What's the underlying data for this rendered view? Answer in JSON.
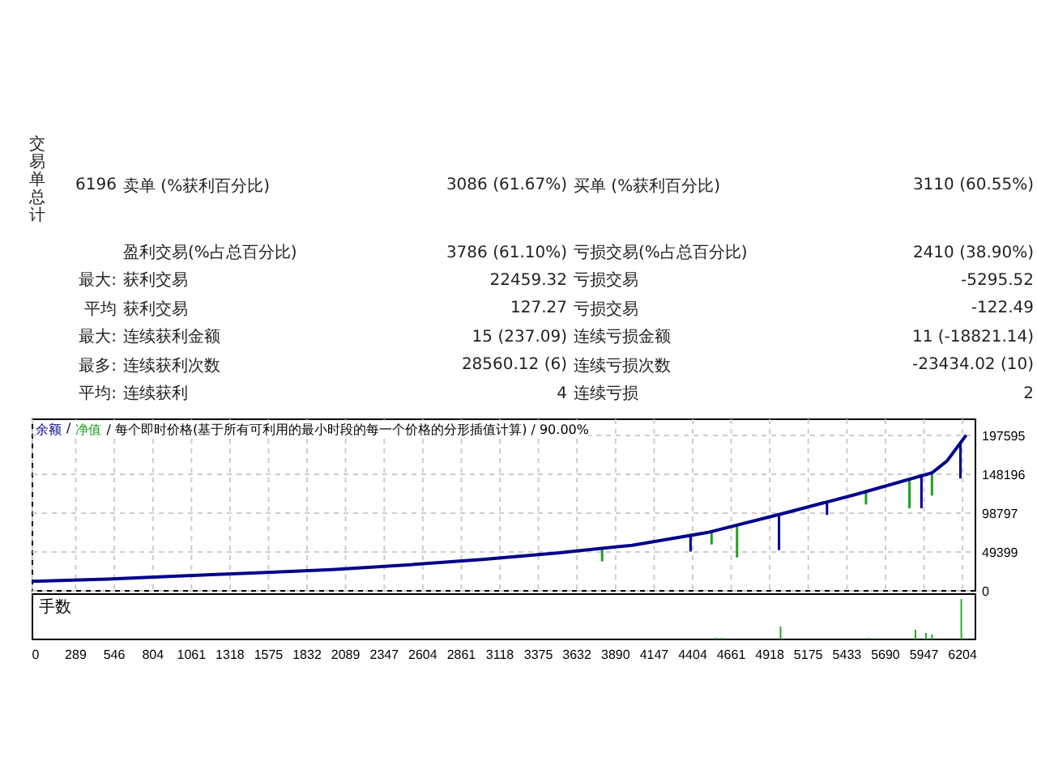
{
  "report": {
    "side_label": "交易单总计",
    "groups": [
      [
        {
          "label": "6196",
          "name": "卖单 (%获利百分比)",
          "value": "3086 (61.67%)",
          "name2": "买单 (%获利百分比)",
          "value2": "3110 (60.55%)"
        }
      ],
      [
        {
          "name": "盈利交易(%占总百分比)",
          "value": "3786 (61.10%)",
          "name2": "亏损交易(%占总百分比)",
          "value2": "2410 (38.90%)"
        },
        {
          "label": "最大:",
          "name": "获利交易",
          "value": "22459.32",
          "name2": "亏损交易",
          "value2": "-5295.52"
        },
        {
          "label": "平均",
          "name": "获利交易",
          "value": "127.27",
          "name2": "亏损交易",
          "value2": "-122.49"
        },
        {
          "label": "最大:",
          "name": "连续获利金额",
          "value": "15 (237.09)",
          "name2": "连续亏损金额",
          "value2": "11 (-18821.14)"
        },
        {
          "label": "最多:",
          "name": "连续获利次数",
          "value": "28560.12 (6)",
          "name2": "连续亏损次数",
          "value2": "-23434.02 (10)"
        },
        {
          "label": "平均:",
          "name": "连续获利",
          "value": "4",
          "name2": "连续亏损",
          "value2": "2"
        }
      ]
    ]
  },
  "chart": {
    "header": [
      {
        "text": "/",
        "color": "#000000"
      },
      {
        "text": "净值",
        "color": "#20a020"
      },
      {
        "text": "/ 每个即时价格(基于所有可利用的最小时段的每一个价格的分形插值计算) / 90.00%",
        "color": "#000000"
      }
    ],
    "volume_label": "手数",
    "chart_data": {
      "type": "line",
      "x": [
        0,
        500,
        1000,
        1500,
        2000,
        2500,
        3000,
        3500,
        4000,
        4500,
        5000,
        5500,
        6000,
        6100,
        6228
      ],
      "series": [
        {
          "name": "余额",
          "color": "#00008b",
          "values": [
            12000,
            15000,
            19000,
            23000,
            27000,
            33000,
            40000,
            48000,
            58000,
            74000,
            98000,
            123000,
            150000,
            165000,
            198000
          ]
        }
      ],
      "grid": true,
      "xlim": [
        0,
        6290
      ],
      "ylim": [
        0,
        218180
      ],
      "xticks": [
        0,
        289,
        546,
        804,
        1061,
        1318,
        1575,
        1832,
        2089,
        2347,
        2604,
        2861,
        3118,
        3375,
        3632,
        3890,
        4147,
        4404,
        4661,
        4918,
        5175,
        5433,
        5690,
        5947,
        6204
      ],
      "yticks": [
        0,
        49399,
        98797,
        148196,
        197595
      ]
    }
  }
}
